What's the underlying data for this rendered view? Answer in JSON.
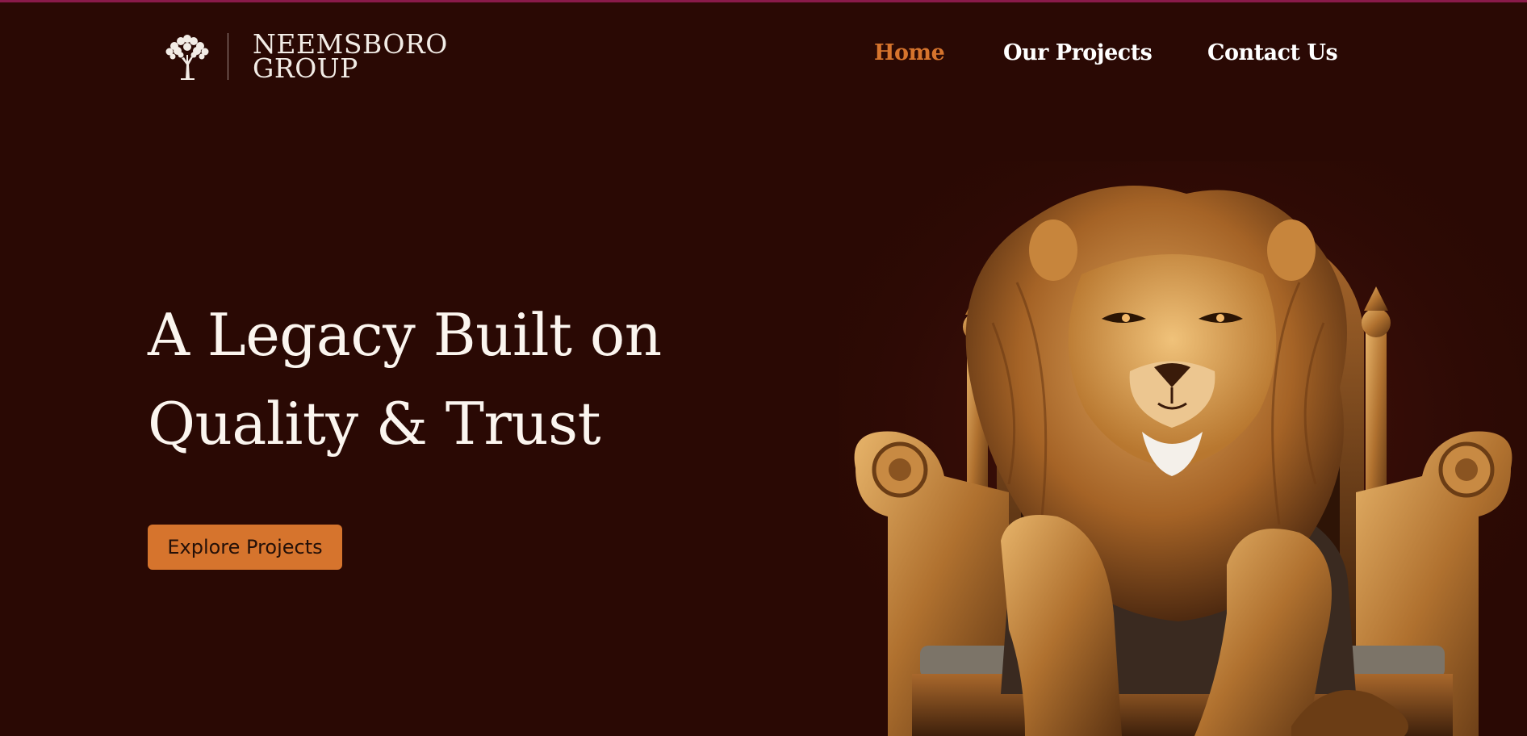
{
  "brand": {
    "name_line1": "NEEMSBORO",
    "name_line2": "GROUP",
    "logo_icon": "tree-icon"
  },
  "nav": {
    "items": [
      {
        "label": "Home",
        "active": true
      },
      {
        "label": "Our Projects",
        "active": false
      },
      {
        "label": "Contact Us",
        "active": false
      }
    ]
  },
  "hero": {
    "title_line1": "A Legacy Built on",
    "title_line2": "Quality & Trust",
    "cta_label": "Explore Projects",
    "image": "lion-on-throne-illustration"
  },
  "colors": {
    "background": "#2a0904",
    "accent": "#d6742d",
    "top_rule": "#8a1a4a",
    "text": "#fbf5ef"
  }
}
